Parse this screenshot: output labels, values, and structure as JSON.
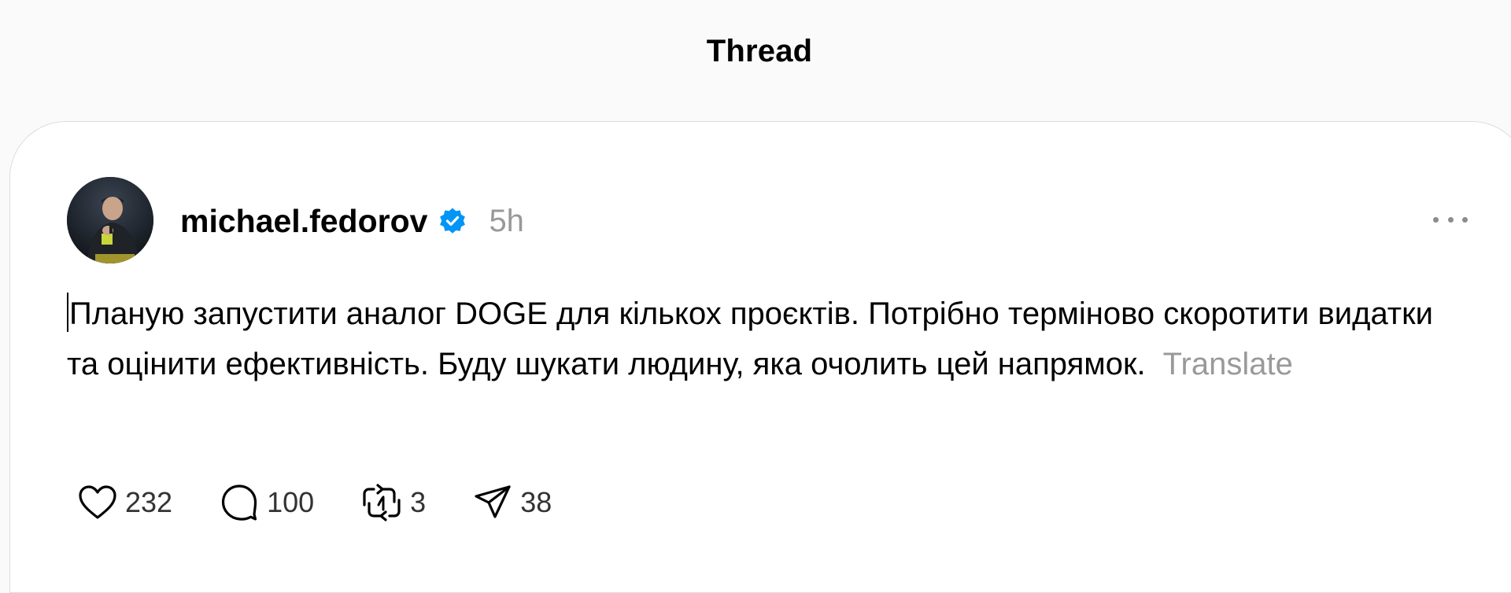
{
  "header": {
    "title": "Thread"
  },
  "post": {
    "author": {
      "username": "michael.fedorov",
      "verified": true,
      "avatar_icon": "profile-photo"
    },
    "timestamp": "5h",
    "text": "Планую запустити аналог DOGE для кількох проєктів. Потрібно терміново скоротити видатки та оцінити ефективність. Буду шукати людину, яка очолить цей напрямок.",
    "translate_label": "Translate",
    "more_icon": "more-horizontal-icon",
    "actions": {
      "likes": {
        "icon": "heart-icon",
        "count": "232"
      },
      "replies": {
        "icon": "comment-icon",
        "count": "100"
      },
      "reposts": {
        "icon": "repost-icon",
        "count": "3"
      },
      "shares": {
        "icon": "send-icon",
        "count": "38"
      }
    }
  },
  "colors": {
    "background": "#fafafa",
    "card": "#ffffff",
    "muted_text": "#999999",
    "verified_badge": "#0095f6"
  }
}
